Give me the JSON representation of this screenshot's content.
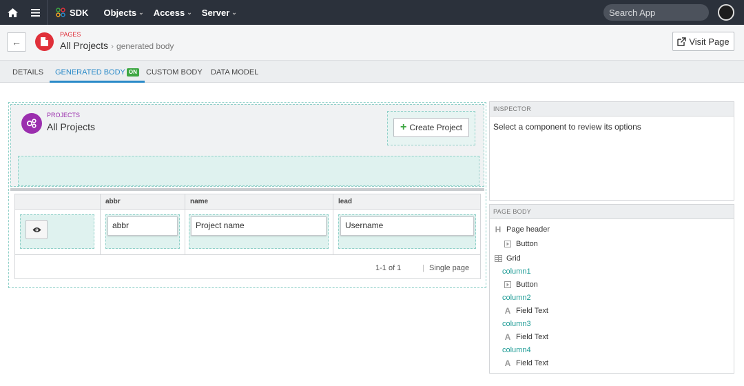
{
  "topnav": {
    "sdk_label": "SDK",
    "objects_label": "Objects",
    "access_label": "Access",
    "server_label": "Server",
    "search_placeholder": "Search App"
  },
  "header": {
    "page_type": "PAGES",
    "title": "All Projects",
    "crumb": "generated body",
    "visit_label": "Visit Page"
  },
  "tabs": [
    {
      "label": "DETAILS"
    },
    {
      "label": "GENERATED BODY",
      "badge": "ON"
    },
    {
      "label": "CUSTOM BODY"
    },
    {
      "label": "DATA MODEL"
    }
  ],
  "canvas": {
    "page_header": {
      "type": "PROJECTS",
      "title": "All Projects",
      "create_label": "Create Project"
    },
    "grid": {
      "columns": [
        "abbr",
        "name",
        "lead"
      ],
      "row": {
        "abbr": "abbr",
        "name": "Project name",
        "lead": "Username"
      },
      "pager": "1-1 of 1",
      "pager_sep": "|",
      "single_page": "Single page"
    }
  },
  "inspector": {
    "title": "INSPECTOR",
    "message": "Select a component to review its options"
  },
  "page_body": {
    "title": "PAGE BODY",
    "items": [
      {
        "label": "Page header",
        "icon": "heading-icon"
      },
      {
        "label": "Button",
        "icon": "button-icon"
      },
      {
        "label": "Grid",
        "icon": "grid-icon"
      },
      {
        "label": "column1",
        "icon": ""
      },
      {
        "label": "Button",
        "icon": "button-icon"
      },
      {
        "label": "column2",
        "icon": ""
      },
      {
        "label": "Field Text",
        "icon": "text-icon"
      },
      {
        "label": "column3",
        "icon": ""
      },
      {
        "label": "Field Text",
        "icon": "text-icon"
      },
      {
        "label": "column4",
        "icon": ""
      },
      {
        "label": "Field Text",
        "icon": "text-icon"
      }
    ]
  },
  "colors": {
    "nav_bg": "#2b313b",
    "accent": "#2a8ac8",
    "page_icon": "#e0303a",
    "project_icon": "#9b2fae",
    "on_badge": "#3ea743",
    "dropzone": "#dff2ef",
    "column_text": "#1a9a94"
  }
}
